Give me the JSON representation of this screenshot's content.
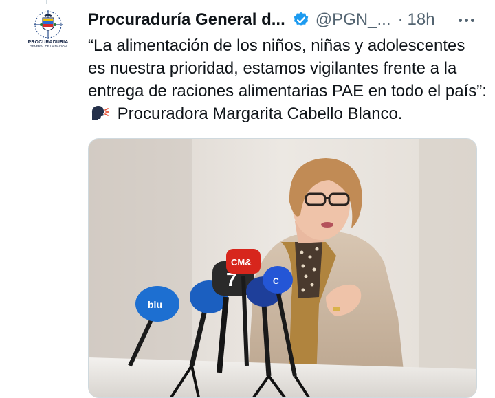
{
  "tweet": {
    "author_name": "Procuraduría General d...",
    "handle": "@PGN_...",
    "separator": "·",
    "time": "18h",
    "text_part1": "“La alimentación de los niños, niñas y adolescentes es nuestra prioridad, estamos vigilantes frente a la entrega de raciones alimentarias PAE en todo el país”:",
    "speaking_emoji": "speaking-head-icon",
    "text_part2": "Procuradora Margarita Cabello Blanco."
  },
  "avatar": {
    "org_line1": "PROCURADURIA",
    "org_line2": "GENERAL DE LA NACION"
  },
  "colors": {
    "text": "#0f1419",
    "muted": "#536471",
    "verified": "#1d9bf0",
    "border": "#cfd9de"
  },
  "photo": {
    "description_icons": [
      "microphone-icon",
      "person-icon"
    ],
    "mic_labels": [
      "blu",
      "CM&",
      "7",
      "C"
    ]
  }
}
